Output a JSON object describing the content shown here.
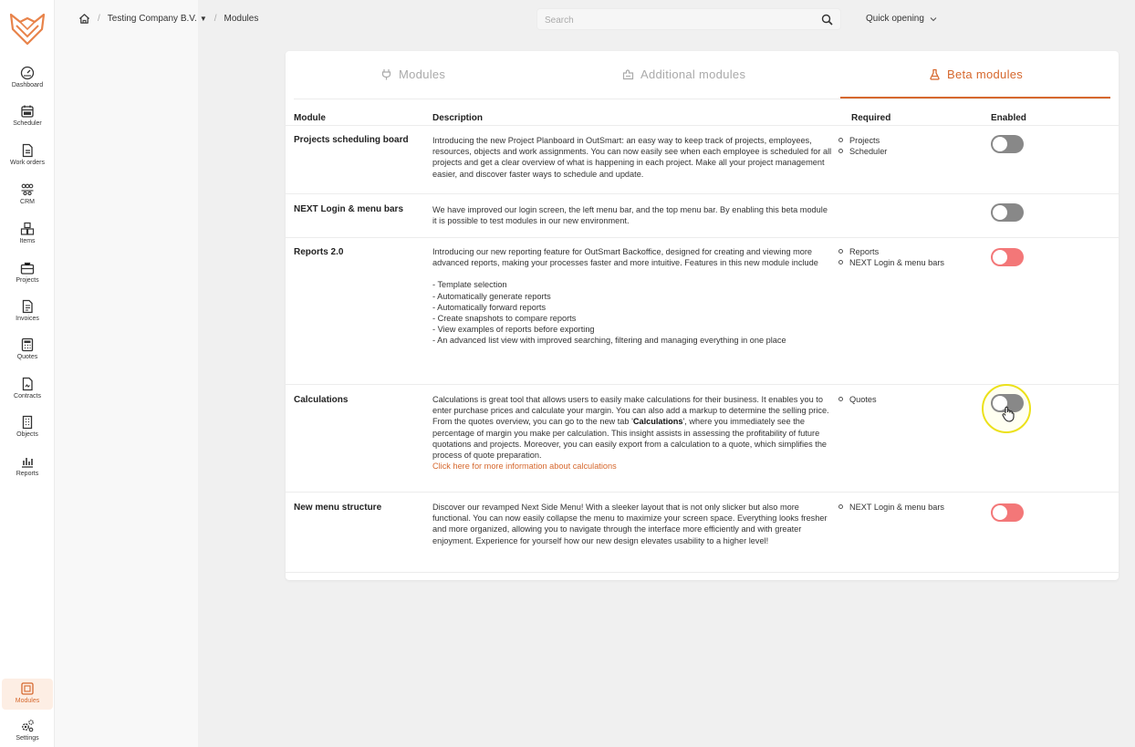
{
  "sidebar": {
    "items": [
      {
        "label": "Dashboard",
        "icon": "dashboard-icon"
      },
      {
        "label": "Scheduler",
        "icon": "calendar-icon"
      },
      {
        "label": "Work orders",
        "icon": "document-icon"
      },
      {
        "label": "CRM",
        "icon": "people-icon"
      },
      {
        "label": "Items",
        "icon": "boxes-icon"
      },
      {
        "label": "Projects",
        "icon": "briefcase-icon"
      },
      {
        "label": "Invoices",
        "icon": "invoice-icon"
      },
      {
        "label": "Quotes",
        "icon": "calculator-icon"
      },
      {
        "label": "Contracts",
        "icon": "contract-icon"
      },
      {
        "label": "Objects",
        "icon": "building-icon"
      },
      {
        "label": "Reports",
        "icon": "bar-chart-icon"
      }
    ],
    "bottom_items": [
      {
        "label": "Modules",
        "icon": "modules-icon",
        "active": true
      },
      {
        "label": "Settings",
        "icon": "gears-icon"
      }
    ]
  },
  "header": {
    "breadcrumb": {
      "company": "Testing Company B.V.",
      "page": "Modules"
    },
    "search": {
      "placeholder": "Search"
    },
    "quick_opening": "Quick opening"
  },
  "tabs": [
    {
      "label": "Modules",
      "icon": "plug-icon",
      "active": false
    },
    {
      "label": "Additional modules",
      "icon": "puzzle-icon",
      "active": false
    },
    {
      "label": "Beta modules",
      "icon": "flask-icon",
      "active": true
    }
  ],
  "table": {
    "headers": {
      "module": "Module",
      "description": "Description",
      "required": "Required",
      "enabled": "Enabled"
    },
    "rows": [
      {
        "name": "Projects scheduling board",
        "description": "Introducing the new Project Planboard in OutSmart: an easy way to keep track of projects, employees, resources, objects and work assignments. You can now easily see when each employee is scheduled for all projects and get a clear overview of what is happening in each project. Make all your project management easier, and discover faster ways to schedule and update.",
        "required": [
          "Projects",
          "Scheduler"
        ],
        "enabled": false
      },
      {
        "name": "NEXT Login & menu bars",
        "description": "We have improved our login screen, the left menu bar, and the top menu bar. By enabling this beta module it is possible to test modules in our new environment.",
        "required": [],
        "enabled": false
      },
      {
        "name": "Reports 2.0",
        "description": "Introducing our new reporting feature for OutSmart Backoffice, designed for creating and viewing more advanced reports, making your processes faster and more intuitive. Features in this new module include",
        "features": [
          "- Template selection",
          "- Automatically generate reports",
          "- Automatically forward reports",
          "- Create snapshots to compare reports",
          "- View examples of reports before exporting",
          "- An advanced list view with improved searching, filtering and managing everything in one place"
        ],
        "required": [
          "Reports",
          "NEXT Login & menu bars"
        ],
        "enabled": true
      },
      {
        "name": "Calculations",
        "description_before": "Calculations is great tool that allows users to easily make calculations for their business. It enables you to enter purchase prices and calculate your margin. You can also add a markup to determine the selling price. From the quotes overview, you can go to the new tab '",
        "description_bold": "Calculations",
        "description_after": "', where you immediately see the percentage of margin you make per calculation. This insight assists in assessing the profitability of future quotations and projects. Moreover, you can easily export from a calculation to a quote, which simplifies the process of quote preparation.",
        "link": "Click here for more information about calculations",
        "required": [
          "Quotes"
        ],
        "enabled": false
      },
      {
        "name": "New menu structure",
        "description": "Discover our revamped Next Side Menu! With a sleeker layout that is not only slicker but also more functional. You can now easily collapse the menu to maximize your screen space. Everything looks fresher and more organized, allowing you to navigate through the interface more efficiently and with greater enjoyment. Experience for yourself how our new design elevates usability to a higher level!",
        "required": [
          "NEXT Login & menu bars"
        ],
        "enabled": true
      }
    ]
  },
  "colors": {
    "accent": "#d6682e",
    "toggle_on": "#f37778",
    "toggle_off": "#888888",
    "highlight": "#ece11a"
  }
}
